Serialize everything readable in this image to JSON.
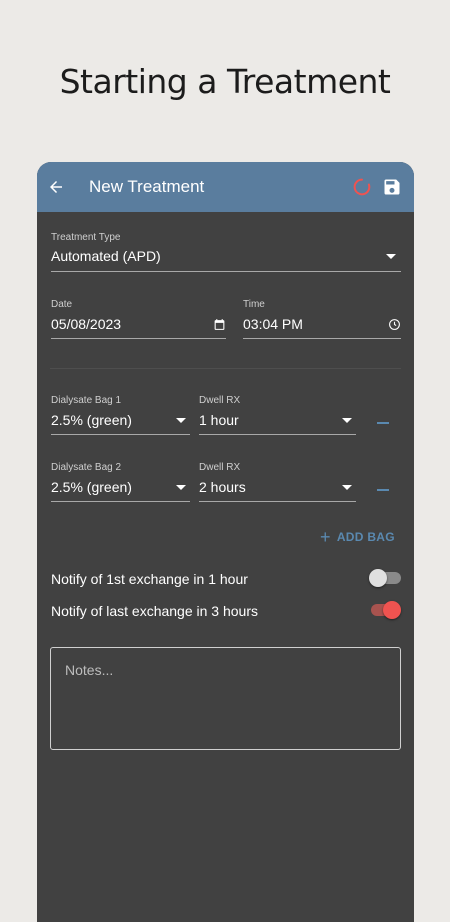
{
  "headline": "Starting a Treatment",
  "appbar": {
    "title": "New Treatment"
  },
  "treatment_type": {
    "label": "Treatment Type",
    "value": "Automated (APD)"
  },
  "date": {
    "label": "Date",
    "value": "05/08/2023"
  },
  "time": {
    "label": "Time",
    "value": "03:04 PM"
  },
  "bags": [
    {
      "bag_label": "Dialysate Bag 1",
      "bag_value": "2.5% (green)",
      "dwell_label": "Dwell RX",
      "dwell_value": "1 hour"
    },
    {
      "bag_label": "Dialysate Bag 2",
      "bag_value": "2.5% (green)",
      "dwell_label": "Dwell RX",
      "dwell_value": "2 hours"
    }
  ],
  "add_bag_label": "ADD BAG",
  "notify_first": {
    "label": "Notify of 1st exchange in 1 hour",
    "on": false
  },
  "notify_last": {
    "label": "Notify of last exchange in 3 hours",
    "on": true
  },
  "notes": {
    "placeholder": "Notes..."
  },
  "colors": {
    "appbar": "#5a7d9e",
    "background": "#414141",
    "accent": "#5a89b0",
    "toggle_on": "#ef5350"
  }
}
